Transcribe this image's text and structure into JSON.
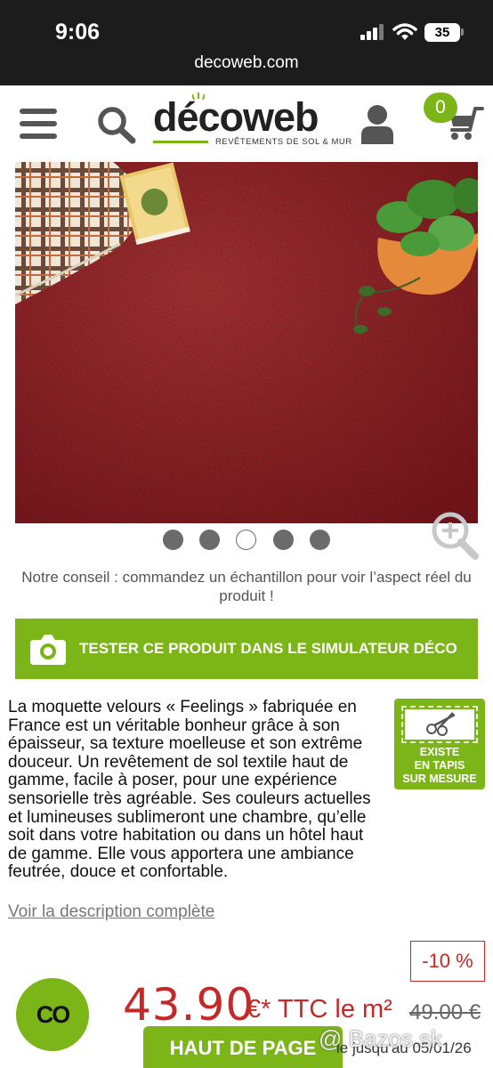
{
  "status_bar": {
    "time": "9:06",
    "battery": "35"
  },
  "browser": {
    "url": "decoweb.com"
  },
  "header": {
    "logo_text": "décoweb",
    "logo_tagline": "REVÊTEMENTS DE SOL & MUR",
    "cart_count": "0"
  },
  "gallery": {
    "dots": 5,
    "active_index": 2
  },
  "advice": "Notre conseil : commandez un échantillon pour voir l’aspect réel du produit !",
  "simulator_button": "TESTER CE PRODUIT DANS LE SIMULATEUR DÉCO",
  "description": {
    "text": "La moquette velours « Feelings » fabriquée en France est un véritable bonheur grâce à son épaisseur, sa texture moelleuse et son extrême douceur. Un revêtement de sol textile haut de gamme, facile à poser, pour une expérience sensorielle très agréable. Ses couleurs actuelles et lumineuses sublimeront une chambre, qu’elle soit dans votre habitation ou dans un hôtel haut de gamme. Elle vous apportera une ambiance feutrée, douce et confortable.",
    "link": "Voir la description complète"
  },
  "custom_badge": {
    "line1": "EXISTE",
    "line2": "EN TAPIS",
    "line3": "SUR MESURE"
  },
  "pricing": {
    "discount": "-10 %",
    "price": "43.90",
    "unit": "€* TTC le m²",
    "old_price": "49.00 €"
  },
  "chat_button": "CO",
  "top_button": "HAUT DE PAGE",
  "sale_note": "le jusqu'au 05/01/26",
  "watermark": "@ Bazos.sk",
  "colors": {
    "brand_green": "#7cb518",
    "price_red": "#c62828"
  }
}
